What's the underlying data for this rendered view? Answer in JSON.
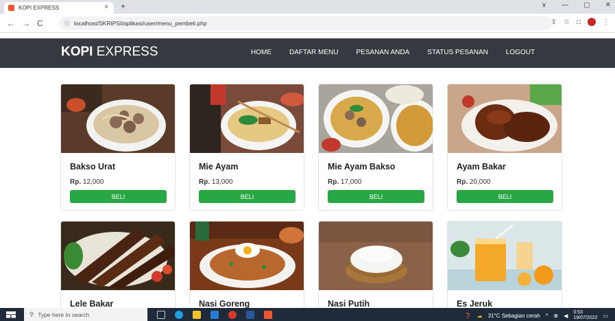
{
  "browser": {
    "tab_title": "KOPI EXPRESS",
    "tab_close": "×",
    "new_tab": "+",
    "url": "localhost/SKRIPSI/aplikasi/user/menu_pembeli.php",
    "nav_back": "←",
    "nav_forward": "→",
    "nav_reload": "C",
    "info_icon": "ⓘ",
    "share_icon": "⇪",
    "star_icon": "☆",
    "sidebar_icon": "□",
    "menu_icon": "⋮",
    "win_minimize": "—",
    "win_maximize": "▢",
    "win_close": "✕",
    "win_dropdown": "∨"
  },
  "navbar": {
    "brand_bold": "KOPI",
    "brand_rest": " EXPRESS",
    "items": [
      {
        "label": "HOME"
      },
      {
        "label": "DAFTAR MENU"
      },
      {
        "label": "PESANAN ANDA"
      },
      {
        "label": "STATUS PESANAN"
      },
      {
        "label": "LOGOUT"
      }
    ]
  },
  "products": [
    {
      "name": "Bakso Urat",
      "currency": "Rp.",
      "price": "12,000",
      "button": "BELI",
      "image": "bakso"
    },
    {
      "name": "Mie Ayam",
      "currency": "Rp.",
      "price": "13,000",
      "button": "BELI",
      "image": "mie-ayam"
    },
    {
      "name": "Mie Ayam Bakso",
      "currency": "Rp.",
      "price": "17,000",
      "button": "BELI",
      "image": "mie-ayam-bakso"
    },
    {
      "name": "Ayam Bakar",
      "currency": "Rp.",
      "price": "20,000",
      "button": "BELI",
      "image": "ayam-bakar"
    },
    {
      "name": "Lele Bakar",
      "image": "lele-bakar"
    },
    {
      "name": "Nasi Goreng",
      "image": "nasi-goreng"
    },
    {
      "name": "Nasi Putih",
      "image": "nasi-putih"
    },
    {
      "name": "Es Jeruk",
      "image": "es-jeruk"
    }
  ],
  "taskbar": {
    "search_placeholder": "Type here to search",
    "weather": "31°C  Sebagian cerah",
    "time": "0:53",
    "date": "19/07/2022"
  },
  "colors": {
    "navbar_bg": "#343a40",
    "button_green": "#28a745",
    "taskbar_bg": "#1f2b3b"
  }
}
